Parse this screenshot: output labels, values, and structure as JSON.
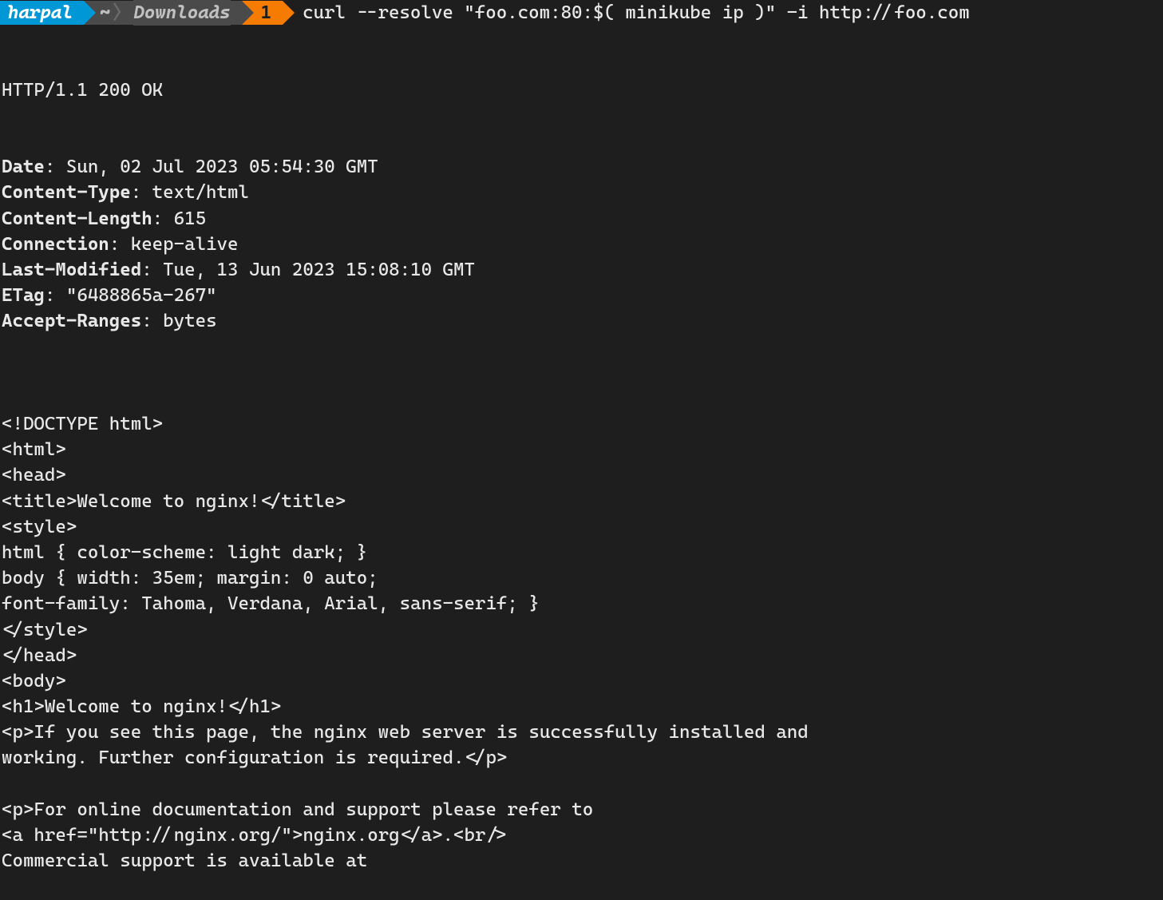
{
  "prompt": {
    "user": "harpal",
    "home": "~",
    "dir": "Downloads",
    "number": "1",
    "command": "curl --resolve \"foo.com:80:$( minikube ip )\" -i http://foo.com"
  },
  "response": {
    "status_line": "HTTP/1.1 200 OK",
    "headers": [
      {
        "key": "Date",
        "value": ": Sun, 02 Jul 2023 05:54:30 GMT"
      },
      {
        "key": "Content-Type",
        "value": ": text/html"
      },
      {
        "key": "Content-Length",
        "value": ": 615"
      },
      {
        "key": "Connection",
        "value": ": keep-alive"
      },
      {
        "key": "Last-Modified",
        "value": ": Tue, 13 Jun 2023 15:08:10 GMT"
      },
      {
        "key": "ETag",
        "value": ": \"6488865a-267\""
      },
      {
        "key": "Accept-Ranges",
        "value": ": bytes"
      }
    ],
    "body_lines": [
      "",
      "<!DOCTYPE html>",
      "<html>",
      "<head>",
      "<title>Welcome to nginx!</title>",
      "<style>",
      "html { color-scheme: light dark; }",
      "body { width: 35em; margin: 0 auto;",
      "font-family: Tahoma, Verdana, Arial, sans-serif; }",
      "</style>",
      "</head>",
      "<body>",
      "<h1>Welcome to nginx!</h1>",
      "<p>If you see this page, the nginx web server is successfully installed and",
      "working. Further configuration is required.</p>",
      "",
      "<p>For online documentation and support please refer to",
      "<a href=\"http://nginx.org/\">nginx.org</a>.<br/>",
      "Commercial support is available at"
    ]
  }
}
